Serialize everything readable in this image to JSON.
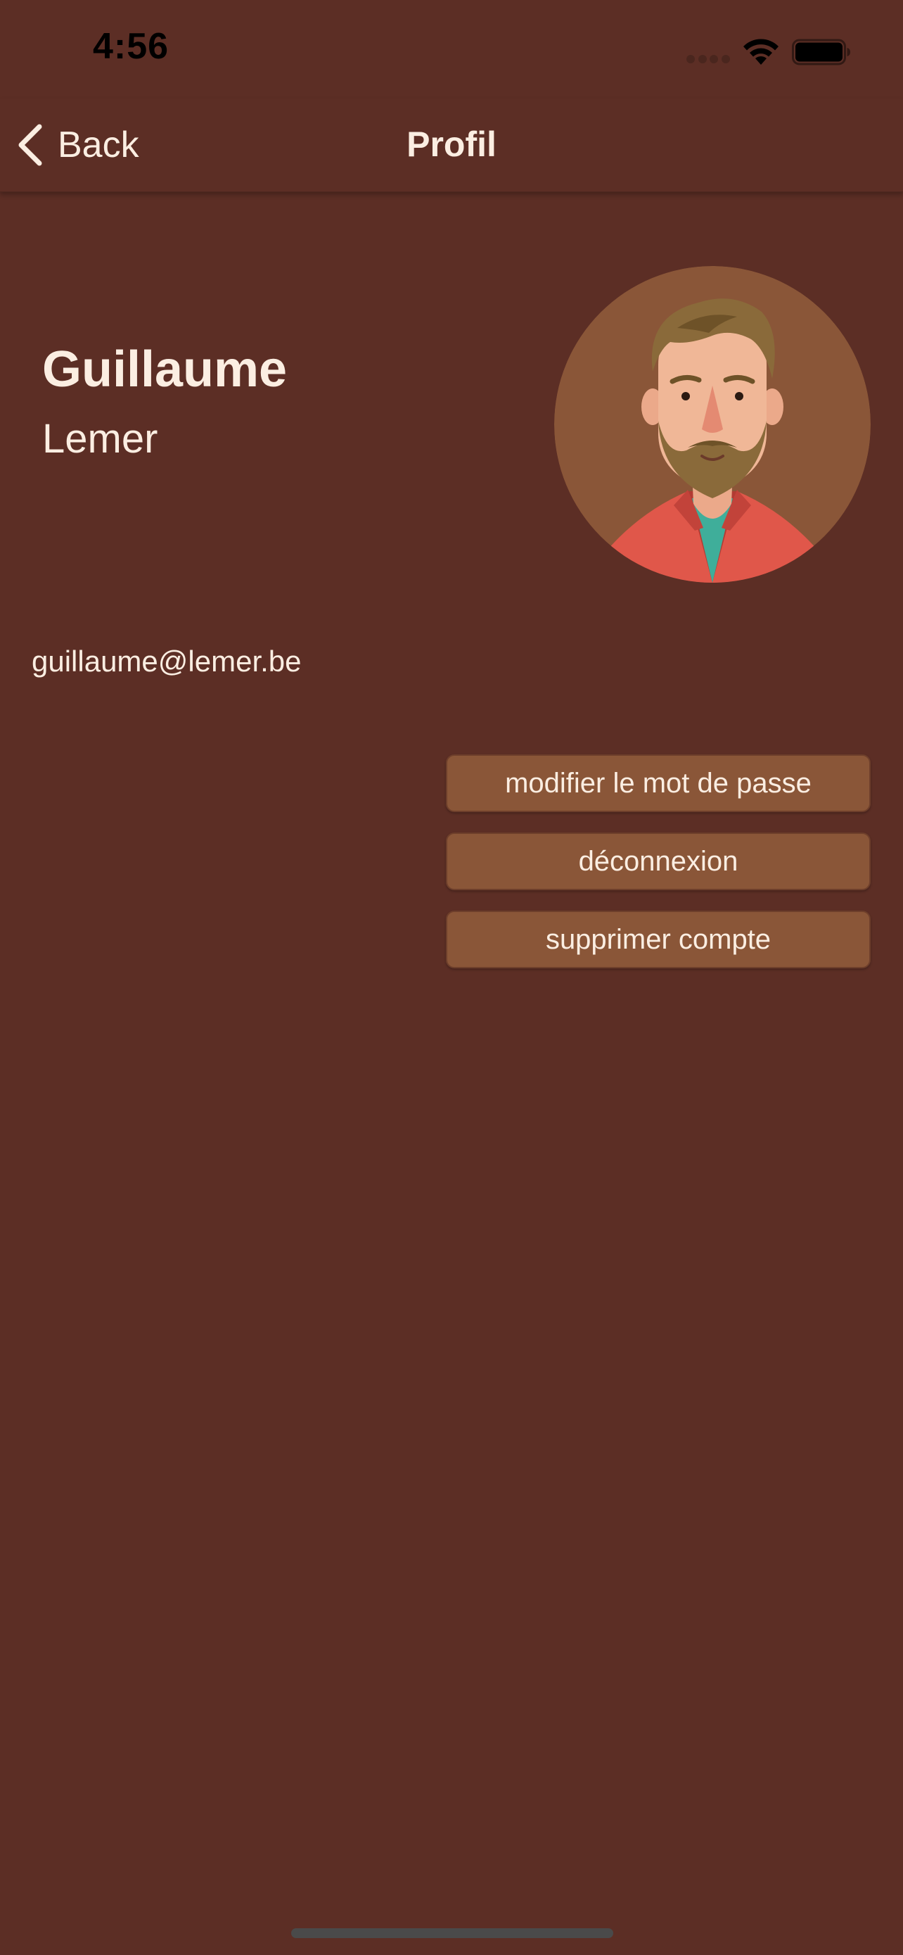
{
  "status_bar": {
    "time": "4:56"
  },
  "nav": {
    "back_label": "Back",
    "title": "Profil"
  },
  "profile": {
    "first_name": "Guillaume",
    "last_name": "Lemer",
    "email": "guillaume@lemer.be",
    "avatar_icon": "bearded-man-avatar-icon"
  },
  "actions": {
    "change_password_label": "modifier le mot de passe",
    "logout_label": "déconnexion",
    "delete_account_label": "supprimer compte"
  },
  "colors": {
    "background": "#5c2e25",
    "button": "#8a5638",
    "text": "#fbeee2",
    "avatar_background": "#8a5638"
  }
}
